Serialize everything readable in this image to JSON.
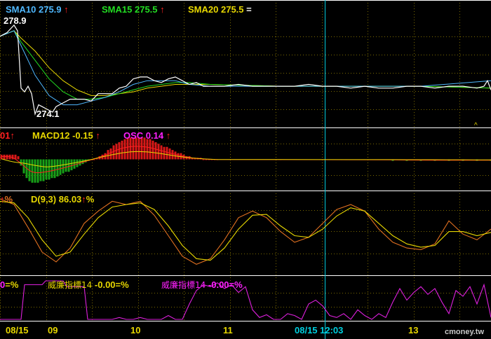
{
  "colors": {
    "sma10": "#4fb8ff",
    "sma15": "#22dd22",
    "sma20": "#e8d800",
    "price": "#ffffff",
    "grid": "#7a6a00",
    "cursor": "#00c8d8",
    "macd_pos": "#d81818",
    "macd_neg": "#18a018",
    "dif": "#ff2020",
    "macd": "#e8d800",
    "osc": "#ff20ff",
    "k": "#e07020",
    "d": "#e8d800",
    "wr": "#dd20dd",
    "divider": "#ffffff"
  },
  "panel_price": {
    "sma10": {
      "label": "SMA10",
      "value": "275.9",
      "arrow": "↑"
    },
    "sma15": {
      "label": "SMA15",
      "value": "275.5",
      "arrow": "↑"
    },
    "sma20": {
      "label": "SMA20",
      "value": "275.5",
      "arrow": "="
    },
    "high_label": "278.9",
    "low_label": "274.1",
    "caret": "^"
  },
  "panel_macd": {
    "dif_fragment": "01",
    "dif_arrow": "↑",
    "macd": {
      "label": "MACD12",
      "value": "-0.15",
      "arrow": "↑"
    },
    "osc": {
      "label": "OSC",
      "value": "0.14",
      "arrow": "↑"
    }
  },
  "panel_kd": {
    "k_fragment_arrow": "↑",
    "k_fragment_unit": "%",
    "d": {
      "label": "D(9,3)",
      "value": "86.03",
      "arrow": "↑",
      "unit": "%"
    }
  },
  "panel_wr": {
    "frag": "0",
    "frag_suffix": "=%",
    "wr1": {
      "label": "威廉指標14",
      "value": "-0.00",
      "suffix": "=%"
    },
    "wr2": {
      "label": "威廉指標14",
      "value": "-0.00",
      "suffix": "=%"
    }
  },
  "x_axis": {
    "labels": [
      "08/15",
      "09",
      "10",
      "11",
      "08/15 12:03",
      "13"
    ]
  },
  "watermark": "cmoney.tw",
  "chart_data": {
    "type": "line",
    "price": {
      "x": [
        0,
        10,
        20,
        25,
        30,
        35,
        40,
        45,
        50,
        55,
        60,
        65,
        70,
        75,
        80,
        90,
        100,
        110,
        120,
        130,
        140,
        150,
        160,
        170,
        180,
        190,
        200,
        210,
        220,
        230,
        240,
        250,
        260,
        270,
        280,
        290,
        300,
        320,
        340,
        360,
        380,
        400,
        420,
        440,
        460,
        480,
        500,
        520,
        540,
        560,
        580,
        600,
        620,
        640,
        660,
        680,
        690,
        695,
        700
      ],
      "y": [
        278.3,
        278.5,
        278.9,
        278.6,
        275.5,
        275.3,
        275.6,
        275.2,
        274.1,
        274.6,
        274.5,
        274.4,
        274.3,
        274.2,
        274.5,
        274.7,
        274.9,
        274.9,
        274.9,
        274.8,
        275.2,
        275.2,
        275.2,
        275.5,
        275.6,
        276.0,
        276.1,
        276.1,
        275.9,
        275.8,
        276.0,
        276.1,
        275.9,
        275.7,
        275.8,
        275.6,
        275.6,
        275.6,
        275.7,
        275.6,
        275.6,
        275.6,
        275.6,
        275.7,
        275.6,
        275.6,
        275.5,
        275.6,
        275.5,
        275.5,
        275.6,
        275.6,
        275.5,
        275.6,
        275.6,
        275.5,
        275.6,
        275.9,
        275.4
      ]
    },
    "sma10": {
      "x": [
        0,
        20,
        30,
        50,
        70,
        90,
        110,
        130,
        150,
        170,
        190,
        210,
        230,
        250,
        270,
        300,
        400,
        500,
        600,
        700
      ],
      "y": [
        278.3,
        278.6,
        277.8,
        276.2,
        275.1,
        274.6,
        274.6,
        274.8,
        275.0,
        275.3,
        275.7,
        275.9,
        275.9,
        275.9,
        275.7,
        275.6,
        275.6,
        275.6,
        275.6,
        275.9
      ]
    },
    "sma15": {
      "x": [
        0,
        20,
        30,
        50,
        70,
        90,
        110,
        130,
        150,
        170,
        190,
        210,
        230,
        250,
        270,
        300,
        400,
        500,
        600,
        700
      ],
      "y": [
        278.3,
        278.6,
        278.0,
        277.0,
        276.0,
        275.3,
        274.9,
        274.9,
        275.0,
        275.2,
        275.4,
        275.6,
        275.7,
        275.8,
        275.8,
        275.7,
        275.6,
        275.6,
        275.6,
        275.5
      ]
    },
    "sma20": {
      "x": [
        0,
        20,
        30,
        50,
        70,
        90,
        110,
        130,
        150,
        170,
        190,
        210,
        230,
        250,
        270,
        300,
        400,
        500,
        600,
        700
      ],
      "y": [
        278.3,
        278.6,
        278.2,
        277.5,
        276.6,
        275.9,
        275.4,
        275.1,
        275.1,
        275.2,
        275.3,
        275.5,
        275.6,
        275.7,
        275.7,
        275.7,
        275.6,
        275.6,
        275.6,
        275.5
      ]
    },
    "macd_hist": {
      "x": [
        2,
        6,
        10,
        14,
        18,
        22,
        26,
        30,
        34,
        38,
        42,
        46,
        50,
        54,
        58,
        62,
        66,
        70,
        74,
        78,
        82,
        86,
        90,
        94,
        98,
        102,
        106,
        110,
        114,
        118,
        122,
        126,
        130,
        134,
        138,
        142,
        146,
        150,
        154,
        158,
        162,
        166,
        170,
        174,
        178,
        182,
        186,
        190,
        194,
        198,
        202,
        206,
        210,
        214,
        218,
        222,
        226,
        230,
        234,
        238,
        242,
        246,
        250,
        254,
        258,
        262,
        266,
        270,
        274,
        278,
        282,
        286,
        290,
        294,
        298,
        302,
        306,
        310,
        400,
        500,
        560,
        580,
        600,
        620,
        640,
        660,
        680,
        700
      ],
      "y": [
        0.03,
        0.03,
        0.03,
        0.03,
        0.03,
        0.03,
        0.02,
        -0.04,
        -0.09,
        -0.12,
        -0.14,
        -0.15,
        -0.15,
        -0.15,
        -0.14,
        -0.14,
        -0.13,
        -0.13,
        -0.12,
        -0.12,
        -0.11,
        -0.1,
        -0.09,
        -0.08,
        -0.08,
        -0.07,
        -0.06,
        -0.05,
        -0.04,
        -0.03,
        -0.02,
        -0.01,
        -0.0,
        0.0,
        0.01,
        0.02,
        0.03,
        0.04,
        0.06,
        0.07,
        0.09,
        0.1,
        0.11,
        0.12,
        0.13,
        0.14,
        0.14,
        0.14,
        0.14,
        0.14,
        0.14,
        0.14,
        0.13,
        0.13,
        0.12,
        0.11,
        0.1,
        0.09,
        0.08,
        0.08,
        0.07,
        0.06,
        0.05,
        0.04,
        0.04,
        0.03,
        0.02,
        0.02,
        0.01,
        0.01,
        0.01,
        0.01,
        0.0,
        0.0,
        0.0,
        0.0,
        0.0,
        0.0,
        0.0,
        0.0,
        -0.01,
        -0.01,
        -0.01,
        -0.01,
        -0.01,
        -0.01,
        -0.01,
        -0.01
      ]
    },
    "kd": {
      "k": {
        "x": [
          0,
          20,
          40,
          60,
          80,
          100,
          120,
          140,
          160,
          180,
          200,
          220,
          240,
          260,
          280,
          300,
          320,
          340,
          360,
          380,
          400,
          420,
          440,
          460,
          480,
          500,
          520,
          540,
          560,
          580,
          600,
          620,
          640,
          660,
          680,
          700
        ],
        "y": [
          95,
          88,
          60,
          30,
          18,
          35,
          65,
          80,
          92,
          88,
          92,
          75,
          50,
          25,
          15,
          22,
          45,
          72,
          80,
          72,
          55,
          42,
          48,
          65,
          82,
          88,
          80,
          58,
          42,
          35,
          33,
          40,
          68,
          52,
          45,
          58
        ]
      },
      "d": {
        "x": [
          0,
          20,
          40,
          60,
          80,
          100,
          120,
          140,
          160,
          180,
          200,
          220,
          240,
          260,
          280,
          300,
          320,
          340,
          360,
          380,
          400,
          420,
          440,
          460,
          480,
          500,
          520,
          540,
          560,
          580,
          600,
          620,
          640,
          660,
          680,
          700
        ],
        "y": [
          92,
          90,
          72,
          45,
          25,
          30,
          52,
          72,
          85,
          88,
          90,
          82,
          62,
          38,
          22,
          20,
          35,
          58,
          75,
          76,
          62,
          50,
          48,
          58,
          74,
          84,
          80,
          65,
          50,
          40,
          36,
          38,
          55,
          55,
          50,
          54
        ]
      }
    },
    "wr": {
      "x": [
        0,
        30,
        35,
        60,
        65,
        90,
        95,
        120,
        125,
        150,
        160,
        170,
        180,
        190,
        200,
        210,
        220,
        230,
        240,
        250,
        260,
        270,
        280,
        290,
        300,
        310,
        320,
        330,
        340,
        350,
        360,
        370,
        380,
        390,
        400,
        410,
        420,
        430,
        440,
        450,
        460,
        470,
        480,
        490,
        500,
        510,
        520,
        530,
        540,
        550,
        560,
        570,
        580,
        590,
        600,
        610,
        620,
        630,
        640,
        650,
        660,
        670,
        680,
        690,
        700
      ],
      "y": [
        100,
        100,
        10,
        10,
        0,
        0,
        15,
        15,
        100,
        100,
        100,
        95,
        100,
        100,
        95,
        100,
        100,
        100,
        90,
        100,
        100,
        60,
        25,
        10,
        15,
        5,
        20,
        10,
        30,
        15,
        75,
        95,
        88,
        100,
        100,
        85,
        90,
        100,
        60,
        50,
        65,
        90,
        95,
        85,
        100,
        75,
        90,
        100,
        85,
        95,
        55,
        20,
        50,
        30,
        15,
        35,
        20,
        55,
        85,
        25,
        40,
        15,
        60,
        10,
        95
      ]
    }
  }
}
